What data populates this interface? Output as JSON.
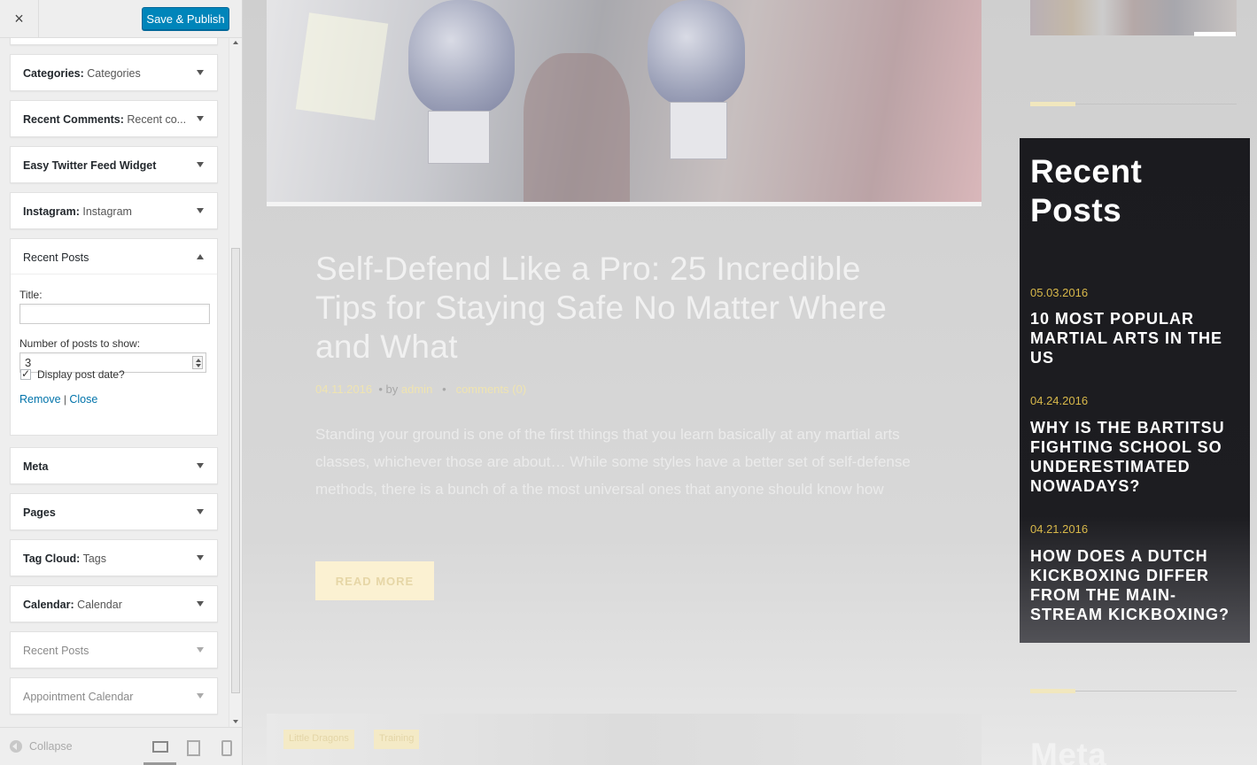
{
  "panel": {
    "close_glyph": "×",
    "save_label": "Save & Publish",
    "widgets_top": [
      {
        "name": "Categories:",
        "sub": " Categories"
      },
      {
        "name": "Recent Comments:",
        "sub": " Recent co..."
      },
      {
        "name": "Easy Twitter Feed Widget",
        "sub": ""
      },
      {
        "name": "Instagram:",
        "sub": " Instagram"
      }
    ],
    "open_widget": {
      "name": "Recent Posts",
      "title_label": "Title:",
      "title_value": "",
      "count_label": "Number of posts to show:",
      "count_value": "3",
      "date_label": "Display post date?",
      "date_checked": true,
      "remove_label": "Remove",
      "separator": "|",
      "close_label": "Close"
    },
    "widgets_bottom": [
      {
        "name": "Meta",
        "sub": ""
      },
      {
        "name": "Pages",
        "sub": ""
      },
      {
        "name": "Tag Cloud:",
        "sub": " Tags"
      },
      {
        "name": "Calendar:",
        "sub": " Calendar"
      },
      {
        "name": "Recent Posts",
        "sub": ""
      },
      {
        "name": "Appointment Calendar",
        "sub": ""
      }
    ],
    "footer": {
      "collapse_label": "Collapse",
      "devices": [
        "desktop-icon",
        "tablet-icon",
        "mobile-icon"
      ]
    }
  },
  "post": {
    "title": "Self-Defend Like a Pro: 25 Incredible Tips for Staying Safe No Matter Where and What",
    "date": "04.11.2016",
    "by": "by",
    "author": "admin",
    "bullet": "•",
    "comments": "comments (0)",
    "excerpt": "Standing your ground is one of the first things that you learn basically at any martial arts classes, whichever those are about… While some styles have a better set of self-defense methods, there is a bunch of a the most universal ones that anyone should know how",
    "read_more": "READ MORE",
    "tags": [
      "Little Dragons",
      "Training"
    ]
  },
  "sidebar": {
    "recent_title": "Recent Posts",
    "recent_posts": [
      {
        "date": "05.03.2016",
        "title": "10 Most Popular Martial Arts in the US"
      },
      {
        "date": "04.24.2016",
        "title": "Why Is the Bartitsu Fighting School So Underestimated Nowadays?"
      },
      {
        "date": "04.21.2016",
        "title": "How Does a Dutch Kickboxing Differ from the Main-Stream Kickboxing?"
      }
    ],
    "meta_title": "Meta"
  },
  "colors": {
    "accent": "#0085ba",
    "gold": "#d8b84a",
    "dark_box": "#1b1b1f"
  }
}
